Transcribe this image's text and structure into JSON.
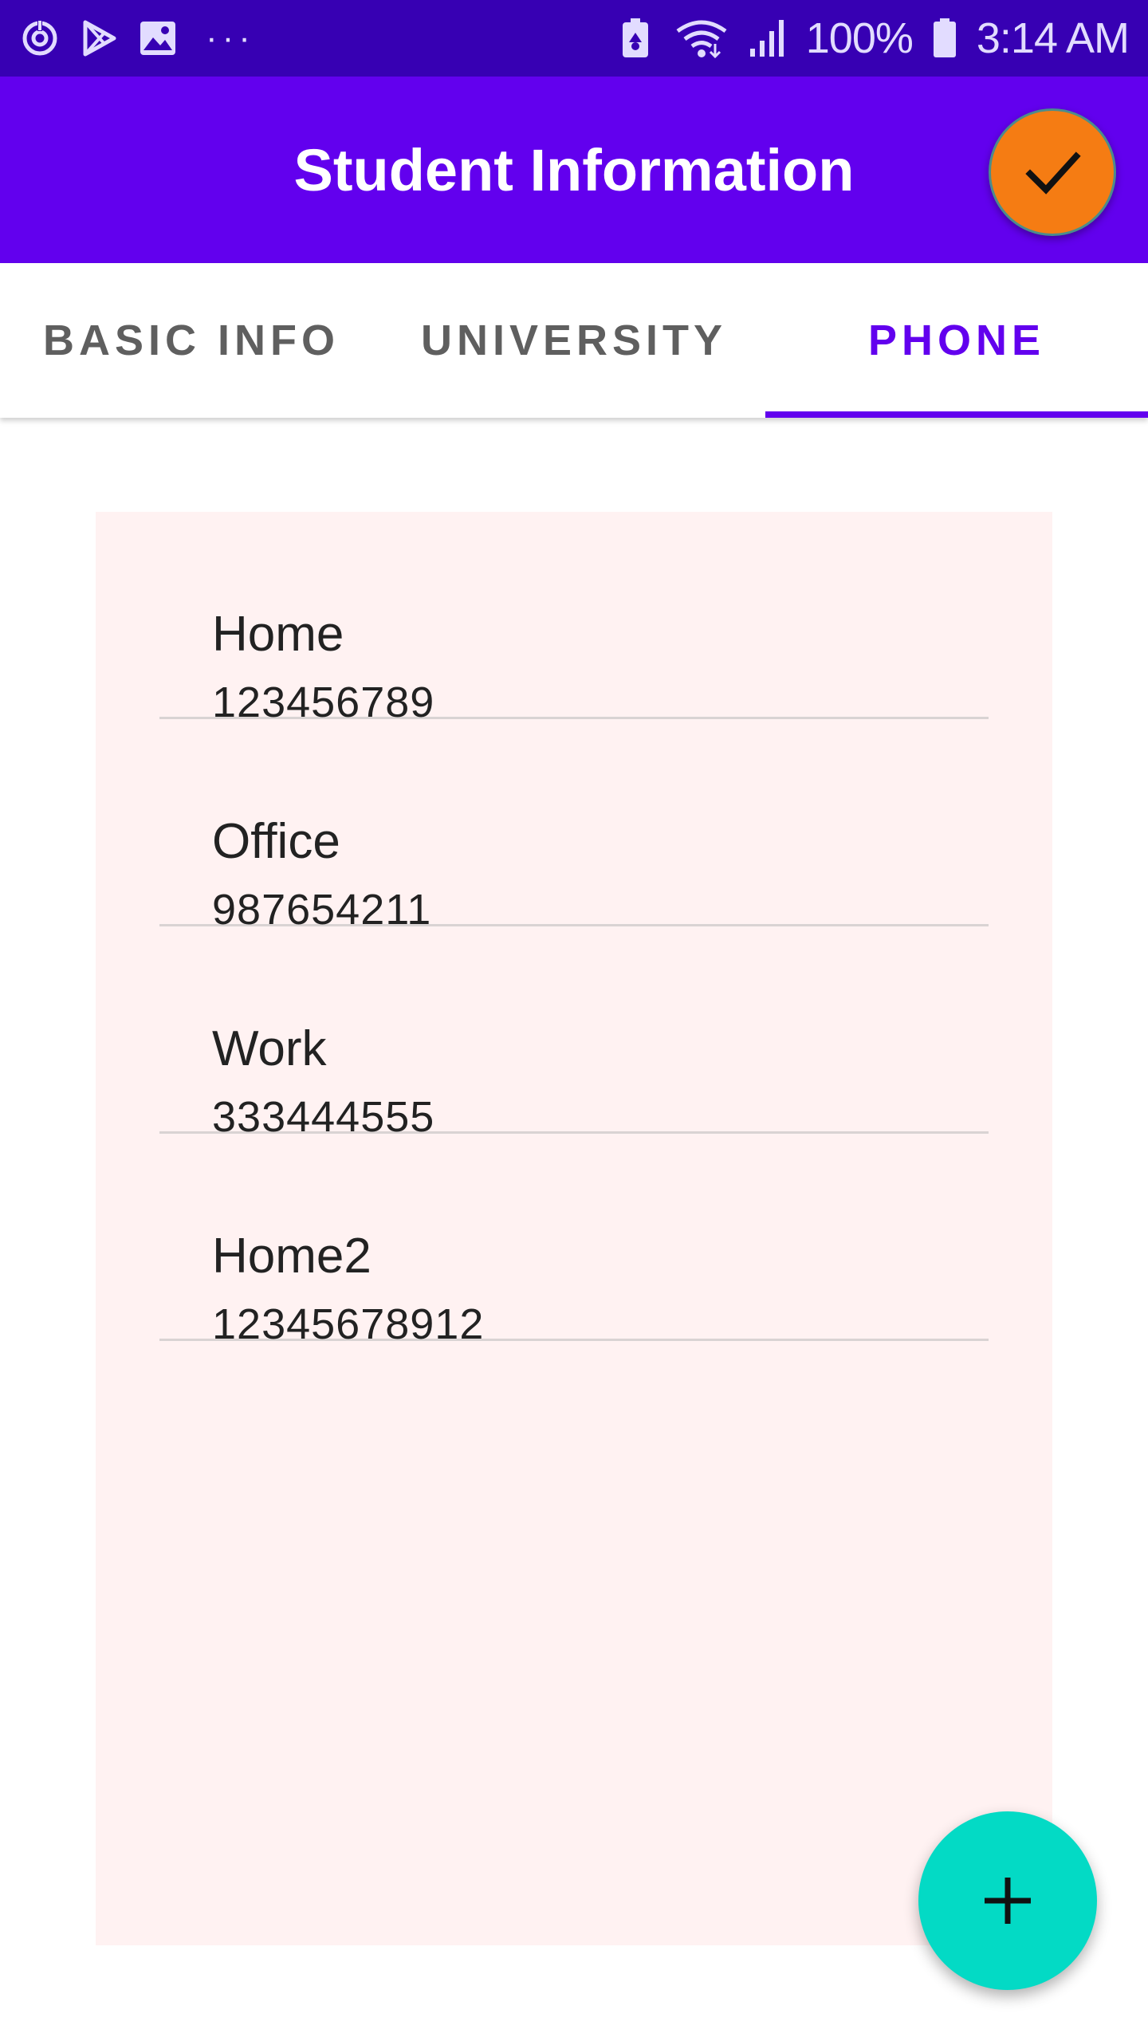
{
  "status_bar": {
    "icons_left": [
      "sync-icon",
      "play-store-icon",
      "gallery-icon",
      "more-dots-icon"
    ],
    "dots": "···",
    "icons_right": [
      "battery-saver-icon",
      "wifi-icon",
      "signal-icon",
      "battery-icon"
    ],
    "battery": "100%",
    "time": "3:14 AM"
  },
  "app_bar": {
    "title": "Student Information",
    "action_icon": "check-icon",
    "action_color": "#f57c13",
    "color": "#6200ee"
  },
  "tabs": [
    {
      "label": "BASIC INFO",
      "active": false
    },
    {
      "label": "UNIVERSITY",
      "active": false
    },
    {
      "label": "PHONE",
      "active": true
    }
  ],
  "phones": [
    {
      "label": "Home",
      "number": "123456789"
    },
    {
      "label": "Office",
      "number": "987654211"
    },
    {
      "label": "Work",
      "number": "333444555"
    },
    {
      "label": "Home2",
      "number": "12345678912"
    }
  ],
  "fab": {
    "icon": "plus-icon",
    "color": "#03dac5"
  }
}
